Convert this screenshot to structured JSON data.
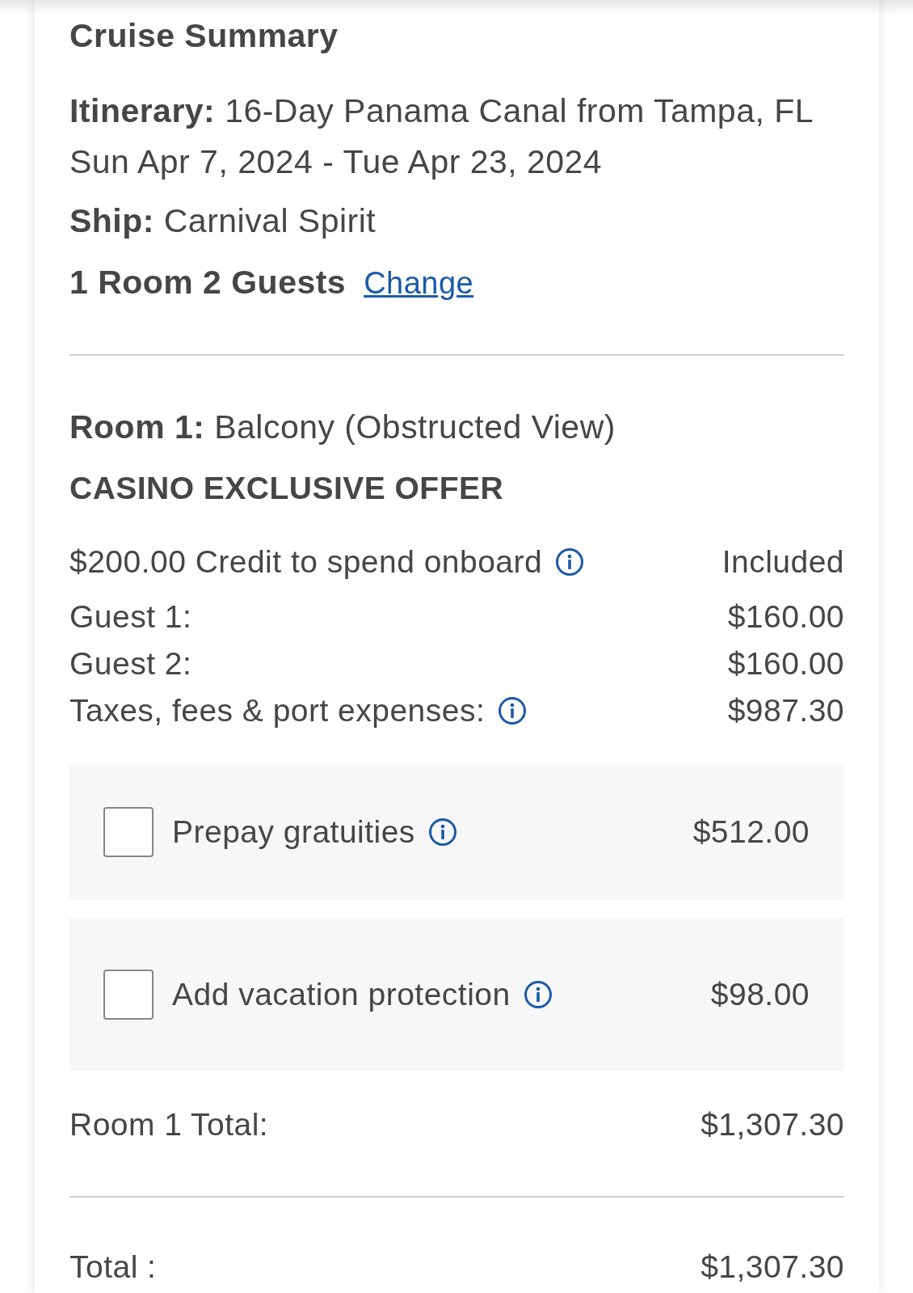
{
  "title": "Cruise Summary",
  "itinerary": {
    "text": "**Itinerary:** 16-Day Panama Canal from Tampa, FL",
    "dates": "Sun Apr 7, 2024 - Tue Apr 23, 2024"
  },
  "ship": {
    "text": "**Ship:** Carnival Spirit"
  },
  "occupancy": {
    "text": "1 Room 2 Guests",
    "link": "Change"
  },
  "room": {
    "text": "**Room 1:** Balcony (Obstructed View)",
    "offer": "CASINO EXCLUSIVE OFFER",
    "lines": [
      {
        "label": "$200.00 Credit to spend onboard",
        "info": true,
        "amount": "Included"
      },
      {
        "label": "Guest 1:",
        "info": false,
        "amount": "$160.00"
      },
      {
        "label": "Guest 2:",
        "info": false,
        "amount": "$160.00"
      },
      {
        "label": "Taxes, fees & port expenses:",
        "info": true,
        "amount": "$987.30"
      }
    ],
    "addons": [
      {
        "label": "Prepay gratuities",
        "checked": false,
        "amount": "$512.00"
      },
      {
        "label": "Add vacation protection",
        "checked": false,
        "amount": "$98.00"
      }
    ],
    "total": {
      "label": "Room 1 Total:",
      "amount": "$1,307.30"
    }
  },
  "total": {
    "label": "Total :",
    "amount": "$1,307.30"
  }
}
